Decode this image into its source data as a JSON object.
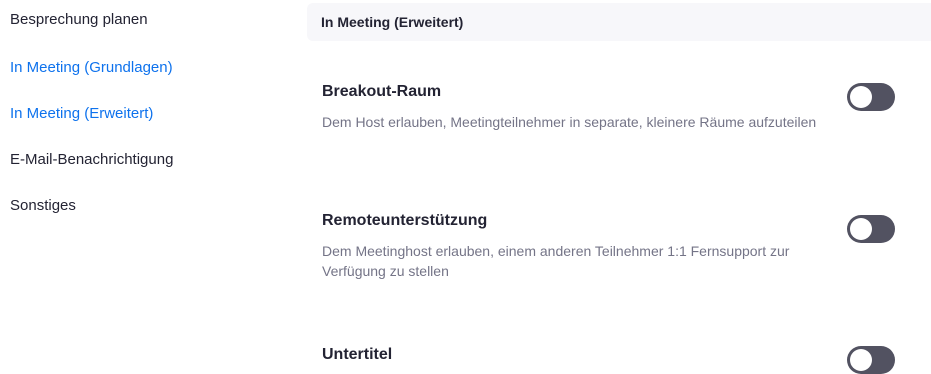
{
  "sidebar": {
    "items": [
      {
        "label": "Besprechung planen",
        "active": false
      },
      {
        "label": "In Meeting (Grundlagen)",
        "active": true
      },
      {
        "label": "In Meeting (Erweitert)",
        "active": true
      },
      {
        "label": "E-Mail-Benachrichtigung",
        "active": false
      },
      {
        "label": "Sonstiges",
        "active": false
      }
    ]
  },
  "section": {
    "title": "In Meeting (Erweitert)"
  },
  "settings": [
    {
      "title": "Breakout-Raum",
      "description": "Dem Host erlauben, Meetingteilnehmer in separate, kleinere Räume aufzuteilen",
      "enabled": false
    },
    {
      "title": "Remoteunterstützung",
      "description": "Dem Meetinghost erlauben, einem anderen Teilnehmer 1:1 Fernsupport zur Verfügung zu stellen",
      "enabled": false
    },
    {
      "title": "Untertitel",
      "description": "",
      "enabled": false
    }
  ],
  "colors": {
    "accent": "#0e72ed",
    "text": "#232333",
    "muted": "#747487",
    "toggle_off": "#525261",
    "header_bg": "#f7f7fa"
  }
}
